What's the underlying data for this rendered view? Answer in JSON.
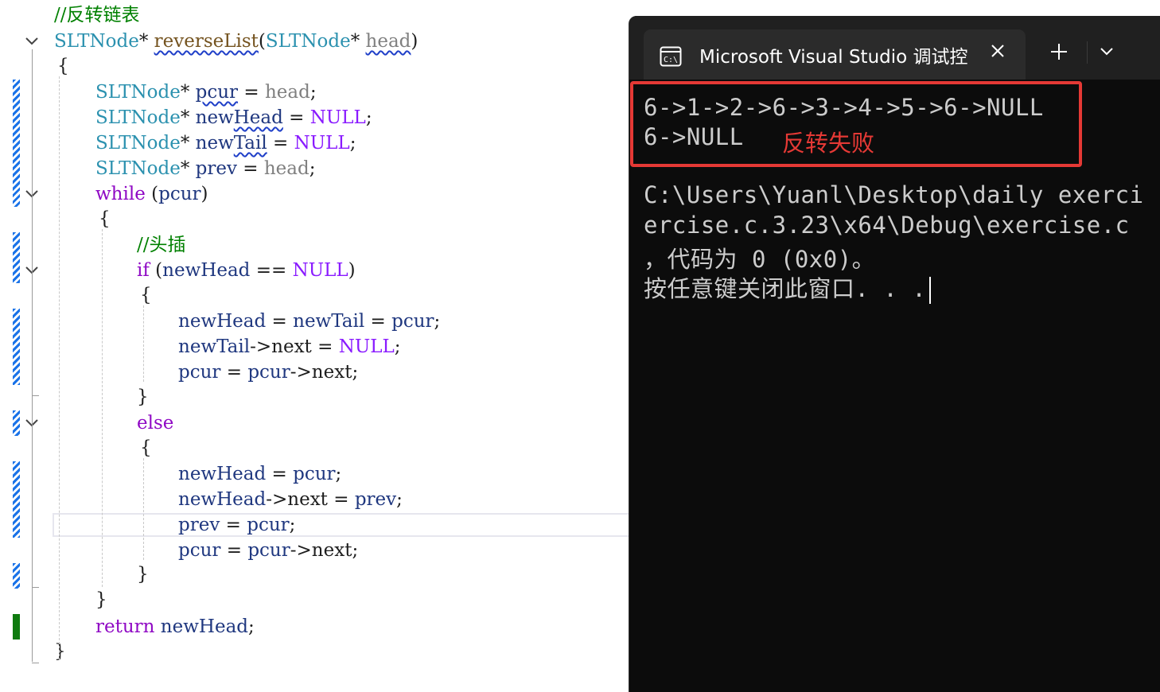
{
  "editor": {
    "lines": [
      {
        "tokens": [
          {
            "c": "tok-comment",
            "t": "//反转链表"
          }
        ]
      },
      {
        "tokens": [
          {
            "c": "tok-type",
            "t": "SLTNode"
          },
          {
            "c": "tok-plain",
            "t": "* "
          },
          {
            "c": "tok-fn squiggle-fn",
            "t": "reverseList"
          },
          {
            "c": "tok-plain",
            "t": "("
          },
          {
            "c": "tok-type",
            "t": "SLTNode"
          },
          {
            "c": "tok-plain",
            "t": "* "
          },
          {
            "c": "tok-param squiggle",
            "t": "head"
          },
          {
            "c": "tok-plain",
            "t": ")"
          }
        ]
      },
      {
        "tokens": [
          {
            "c": "tok-plain",
            "t": "{"
          }
        ]
      },
      {
        "tokens": [
          {
            "c": "tok-type",
            "t": "SLTNode"
          },
          {
            "c": "tok-plain",
            "t": "* "
          },
          {
            "c": "tok-var squiggle",
            "t": "pcur"
          },
          {
            "c": "tok-plain",
            "t": " = "
          },
          {
            "c": "tok-param",
            "t": "head"
          },
          {
            "c": "tok-plain",
            "t": ";"
          }
        ]
      },
      {
        "tokens": [
          {
            "c": "tok-type",
            "t": "SLTNode"
          },
          {
            "c": "tok-plain",
            "t": "* "
          },
          {
            "c": "tok-var",
            "t": "new"
          },
          {
            "c": "tok-var squiggle",
            "t": "Head"
          },
          {
            "c": "tok-plain",
            "t": " = "
          },
          {
            "c": "tok-macro",
            "t": "NULL"
          },
          {
            "c": "tok-plain",
            "t": ";"
          }
        ]
      },
      {
        "tokens": [
          {
            "c": "tok-type",
            "t": "SLTNode"
          },
          {
            "c": "tok-plain",
            "t": "* "
          },
          {
            "c": "tok-var",
            "t": "new"
          },
          {
            "c": "tok-var squiggle",
            "t": "Tail"
          },
          {
            "c": "tok-plain",
            "t": " = "
          },
          {
            "c": "tok-macro",
            "t": "NULL"
          },
          {
            "c": "tok-plain",
            "t": ";"
          }
        ]
      },
      {
        "tokens": [
          {
            "c": "tok-type",
            "t": "SLTNode"
          },
          {
            "c": "tok-plain",
            "t": "* "
          },
          {
            "c": "tok-var",
            "t": "prev"
          },
          {
            "c": "tok-plain",
            "t": " = "
          },
          {
            "c": "tok-param",
            "t": "head"
          },
          {
            "c": "tok-plain",
            "t": ";"
          }
        ]
      },
      {
        "tokens": [
          {
            "c": "tok-kw",
            "t": "while"
          },
          {
            "c": "tok-plain",
            "t": " ("
          },
          {
            "c": "tok-var",
            "t": "pcur"
          },
          {
            "c": "tok-plain",
            "t": ")"
          }
        ]
      },
      {
        "tokens": [
          {
            "c": "tok-plain",
            "t": "{"
          }
        ]
      },
      {
        "tokens": [
          {
            "c": "tok-comment",
            "t": "//头插"
          }
        ]
      },
      {
        "tokens": [
          {
            "c": "tok-kw",
            "t": "if"
          },
          {
            "c": "tok-plain",
            "t": " ("
          },
          {
            "c": "tok-var",
            "t": "newHead"
          },
          {
            "c": "tok-plain",
            "t": " == "
          },
          {
            "c": "tok-macro",
            "t": "NULL"
          },
          {
            "c": "tok-plain",
            "t": ")"
          }
        ]
      },
      {
        "tokens": [
          {
            "c": "tok-plain",
            "t": "{"
          }
        ]
      },
      {
        "tokens": [
          {
            "c": "tok-var",
            "t": "newHead"
          },
          {
            "c": "tok-plain",
            "t": " = "
          },
          {
            "c": "tok-var",
            "t": "newTail"
          },
          {
            "c": "tok-plain",
            "t": " = "
          },
          {
            "c": "tok-var",
            "t": "pcur"
          },
          {
            "c": "tok-plain",
            "t": ";"
          }
        ]
      },
      {
        "tokens": [
          {
            "c": "tok-var",
            "t": "newTail"
          },
          {
            "c": "tok-plain",
            "t": "->"
          },
          {
            "c": "tok-plain",
            "t": "next"
          },
          {
            "c": "tok-plain",
            "t": " = "
          },
          {
            "c": "tok-macro",
            "t": "NULL"
          },
          {
            "c": "tok-plain",
            "t": ";"
          }
        ]
      },
      {
        "tokens": [
          {
            "c": "tok-var",
            "t": "pcur"
          },
          {
            "c": "tok-plain",
            "t": " = "
          },
          {
            "c": "tok-var",
            "t": "pcur"
          },
          {
            "c": "tok-plain",
            "t": "->"
          },
          {
            "c": "tok-plain",
            "t": "next"
          },
          {
            "c": "tok-plain",
            "t": ";"
          }
        ]
      },
      {
        "tokens": [
          {
            "c": "tok-plain",
            "t": "}"
          }
        ]
      },
      {
        "tokens": [
          {
            "c": "tok-kw",
            "t": "else"
          }
        ]
      },
      {
        "tokens": [
          {
            "c": "tok-plain",
            "t": "{"
          }
        ]
      },
      {
        "tokens": [
          {
            "c": "tok-var",
            "t": "newHead"
          },
          {
            "c": "tok-plain",
            "t": " = "
          },
          {
            "c": "tok-var",
            "t": "pcur"
          },
          {
            "c": "tok-plain",
            "t": ";"
          }
        ]
      },
      {
        "tokens": [
          {
            "c": "tok-var",
            "t": "newHead"
          },
          {
            "c": "tok-plain",
            "t": "->"
          },
          {
            "c": "tok-plain",
            "t": "next"
          },
          {
            "c": "tok-plain",
            "t": " = "
          },
          {
            "c": "tok-var",
            "t": "prev"
          },
          {
            "c": "tok-plain",
            "t": ";"
          }
        ]
      },
      {
        "tokens": [
          {
            "c": "tok-var",
            "t": "prev"
          },
          {
            "c": "tok-plain",
            "t": " = "
          },
          {
            "c": "tok-var",
            "t": "pcur"
          },
          {
            "c": "tok-plain",
            "t": ";"
          }
        ]
      },
      {
        "tokens": [
          {
            "c": "tok-var",
            "t": "pcur"
          },
          {
            "c": "tok-plain",
            "t": " = "
          },
          {
            "c": "tok-var",
            "t": "pcur"
          },
          {
            "c": "tok-plain",
            "t": "->"
          },
          {
            "c": "tok-plain",
            "t": "next"
          },
          {
            "c": "tok-plain",
            "t": ";"
          }
        ]
      },
      {
        "tokens": [
          {
            "c": "tok-plain",
            "t": "}"
          }
        ]
      },
      {
        "tokens": [
          {
            "c": "tok-plain",
            "t": "}"
          }
        ]
      },
      {
        "tokens": [
          {
            "c": "tok-kw",
            "t": "return"
          },
          {
            "c": "tok-plain",
            "t": " "
          },
          {
            "c": "tok-var",
            "t": "newHead"
          },
          {
            "c": "tok-plain",
            "t": ";"
          }
        ]
      },
      {
        "tokens": [
          {
            "c": "tok-plain",
            "t": "}"
          }
        ]
      }
    ]
  },
  "terminal": {
    "tab_title": "Microsoft Visual Studio 调试控",
    "icon_text": "C:\\",
    "output_line_1": "6->1->2->6->3->4->5->6->NULL",
    "output_line_2": "6->NULL",
    "annotation": "反转失败",
    "path_line_1": "C:\\Users\\Yuanl\\Desktop\\daily exerci",
    "path_line_2": "ercise.c.3.23\\x64\\Debug\\exercise.c",
    "exit_line": "，代码为 0 (0x0)。",
    "prompt_line": "按任意键关闭此窗口. . ."
  },
  "colors": {
    "annotation_red": "#e53935",
    "terminal_bg": "#0c0c0c",
    "comment_green": "#008000",
    "type_teal": "#2b91af",
    "keyword_purple": "#8f08c4"
  }
}
